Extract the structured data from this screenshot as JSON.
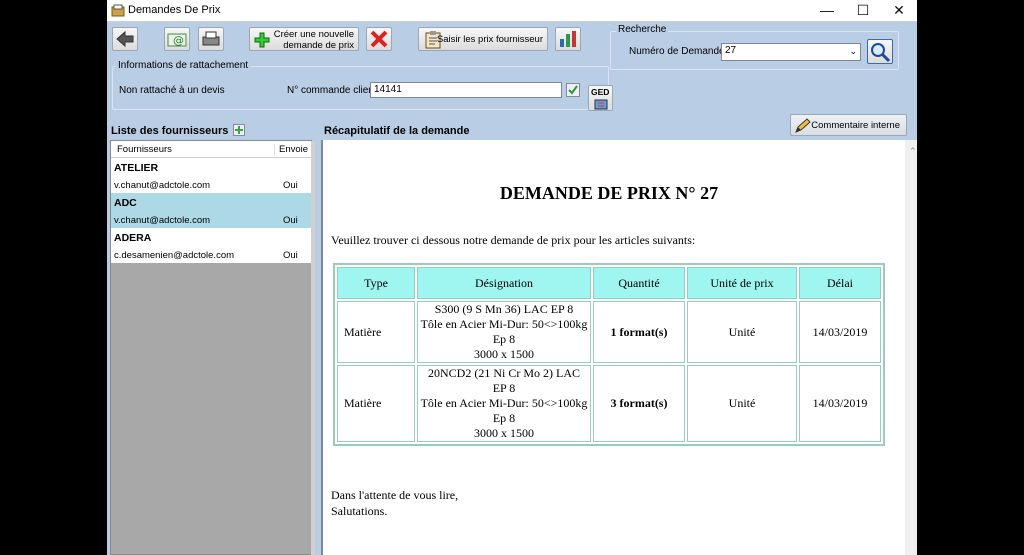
{
  "window": {
    "title": "Demandes De Prix",
    "controls": {
      "minimize": "—",
      "maximize": "☐",
      "close": "✕"
    }
  },
  "toolbar": {
    "create_label_line1": "Créer une nouvelle",
    "create_label_line2": "demande de prix",
    "saisir_label": "Saisir les prix fournisseur"
  },
  "recherche": {
    "legend": "Recherche",
    "numero_label": "Numéro de Demande",
    "numero_value": "27"
  },
  "rattachement": {
    "legend": "Informations de rattachement",
    "devis_status": "Non rattaché à un devis",
    "commande_label": "N° commande client",
    "commande_value": "14141"
  },
  "ged_label": "GED",
  "commentaire_label": "Commentaire interne",
  "fournisseurs": {
    "title": "Liste des fournisseurs",
    "col_fournisseurs": "Fournisseurs",
    "col_envoie": "Envoie",
    "items": [
      {
        "name": "ATELIER",
        "email": "v.chanut@adctole.com",
        "envoie": "Oui"
      },
      {
        "name": "ADC",
        "email": "v.chanut@adctole.com",
        "envoie": "Oui"
      },
      {
        "name": "ADERA",
        "email": "c.desamenien@adctole.com",
        "envoie": "Oui"
      }
    ]
  },
  "recap": {
    "title": "Récapitulatif de la demande",
    "doc_title": "DEMANDE DE PRIX N° 27",
    "intro": "Veuillez trouver ci dessous notre demande de prix pour les articles suivants:",
    "headers": {
      "type": "Type",
      "designation": "Désignation",
      "quantite": "Quantité",
      "unite": "Unité de prix",
      "delai": "Délai"
    },
    "rows": [
      {
        "type": "Matière",
        "designation": [
          "S300 (9 S Mn 36) LAC EP 8",
          "Tôle en Acier Mi-Dur: 50<>100kg",
          "Ep 8",
          "3000 x 1500"
        ],
        "quantite": "1 format(s)",
        "unite": "Unité",
        "delai": "14/03/2019"
      },
      {
        "type": "Matière",
        "designation": [
          "20NCD2 (21 Ni Cr Mo 2) LAC",
          "EP 8",
          "Tôle en Acier Mi-Dur: 50<>100kg",
          "Ep 8",
          "3000 x 1500"
        ],
        "quantite": "3 format(s)",
        "unite": "Unité",
        "delai": "14/03/2019"
      }
    ],
    "closing1": "Dans l'attente de vous lire,",
    "closing2": "Salutations."
  }
}
